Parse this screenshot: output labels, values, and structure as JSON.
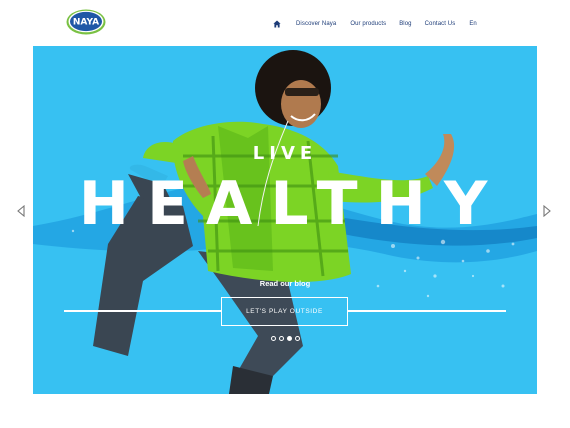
{
  "brand": {
    "logo_text": "NAYA"
  },
  "nav": {
    "home_icon": "home-icon",
    "items": [
      {
        "label": "Discover Naya"
      },
      {
        "label": "Our products"
      },
      {
        "label": "Blog"
      },
      {
        "label": "Contact Us"
      }
    ],
    "language": {
      "label": "En",
      "flag_icon": "us-flag-icon"
    }
  },
  "hero": {
    "title_small": "LIVE",
    "title_large": "HEALTHY",
    "link_text": "Read our blog",
    "cta_label": "LET'S PLAY OUTSIDE",
    "slides": {
      "count": 4,
      "active": 3
    },
    "prev_icon": "chevron-left-icon",
    "next_icon": "chevron-right-icon"
  },
  "colors": {
    "hero_bg": "#37c1f2",
    "nav_text": "#1d3c78",
    "logo_blue": "#1f57a6",
    "logo_green": "#7ac143",
    "shirt_green": "#7cd425",
    "jeans": "#3a4652"
  }
}
